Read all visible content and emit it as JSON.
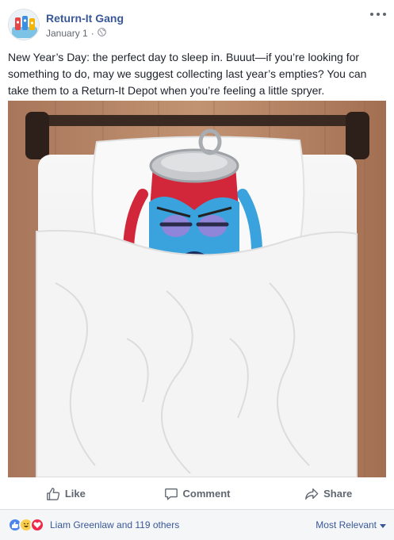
{
  "post": {
    "page_name": "Return-It Gang",
    "date": "January 1",
    "separator": "·",
    "privacy_icon": "globe-icon",
    "menu_icon": "more-options-icon",
    "text": "New Year’s Day: the perfect day to sleep in. Buuut—if you’re looking for something to do, may we suggest collecting last year’s empties? You can take them to a Return-It Depot when you’re feeling a little spryer.",
    "image_subject": "cartoon soda-can character sleeping in a bed"
  },
  "actions": {
    "like": "Like",
    "comment": "Comment",
    "share": "Share"
  },
  "reactions": {
    "icons": [
      "like-reaction-icon",
      "haha-reaction-icon",
      "love-reaction-icon"
    ],
    "summary": "Liam Greenlaw and 119 others",
    "sort_label": "Most Relevant"
  },
  "colors": {
    "link": "#385898",
    "muted": "#606770",
    "bar_bg": "#f5f6f7"
  }
}
